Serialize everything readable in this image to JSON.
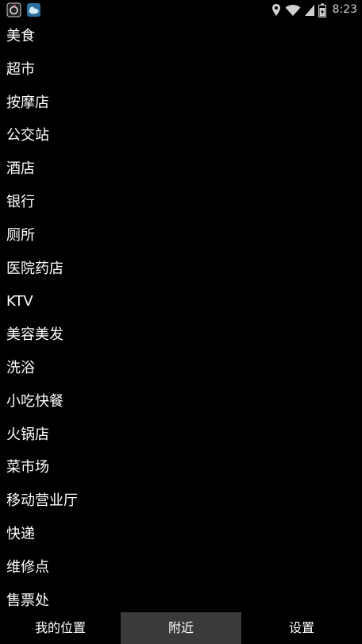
{
  "status_bar": {
    "notification_icons": [
      "app-notification-icon",
      "weather-notification-icon"
    ],
    "system_icons": [
      "location-icon",
      "wifi-icon",
      "signal-icon",
      "battery-icon"
    ],
    "time": "8:23"
  },
  "categories": [
    "美食",
    "超市",
    "按摩店",
    "公交站",
    "酒店",
    "银行",
    "厕所",
    "医院药店",
    "KTV",
    "美容美发",
    "洗浴",
    "小吃快餐",
    "火锅店",
    "菜市场",
    "移动营业厅",
    "快递",
    "维修点",
    "售票处"
  ],
  "tabs": [
    {
      "label": "我的位置",
      "active": false
    },
    {
      "label": "附近",
      "active": true
    },
    {
      "label": "设置",
      "active": false
    }
  ],
  "colors": {
    "background": "#000000",
    "text": "#ffffff",
    "active_tab": "#3a3a3a"
  }
}
